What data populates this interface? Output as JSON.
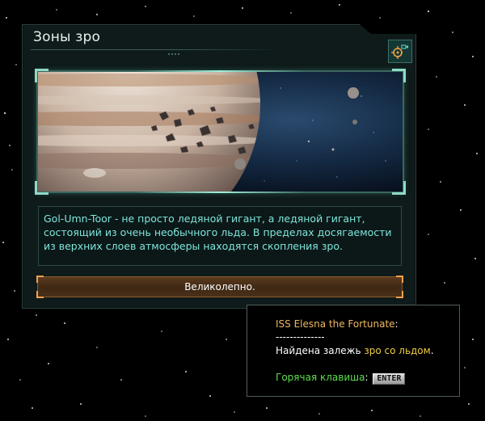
{
  "event": {
    "title": "Зоны зро",
    "description": "Gol-Umn-Toor - не просто ледяной гигант, а ледяной гигант, состоящий из очень необычного льда. В пределах досягаемости из верхних слоев атмосферы находятся скопления зро.",
    "option_label": "Великолепно.",
    "camera_icon": "camera-target-icon"
  },
  "tooltip": {
    "ship_name": "ISS Elesna the Fortunate",
    "ship_suffix": ":",
    "separator": "--------------",
    "found_prefix": "Найдена залежь ",
    "found_resource": "зро со льдом",
    "found_suffix": ".",
    "hotkey_label": "Горячая клавиша",
    "hotkey_colon": ":",
    "hotkey_key": "ENTER"
  },
  "colors": {
    "accent_teal": "#7fe6dc",
    "resource_yellow": "#f0d040",
    "hotkey_green": "#5ce04c",
    "ship_orange": "#f0b860",
    "button_orange": "#f0a050"
  }
}
